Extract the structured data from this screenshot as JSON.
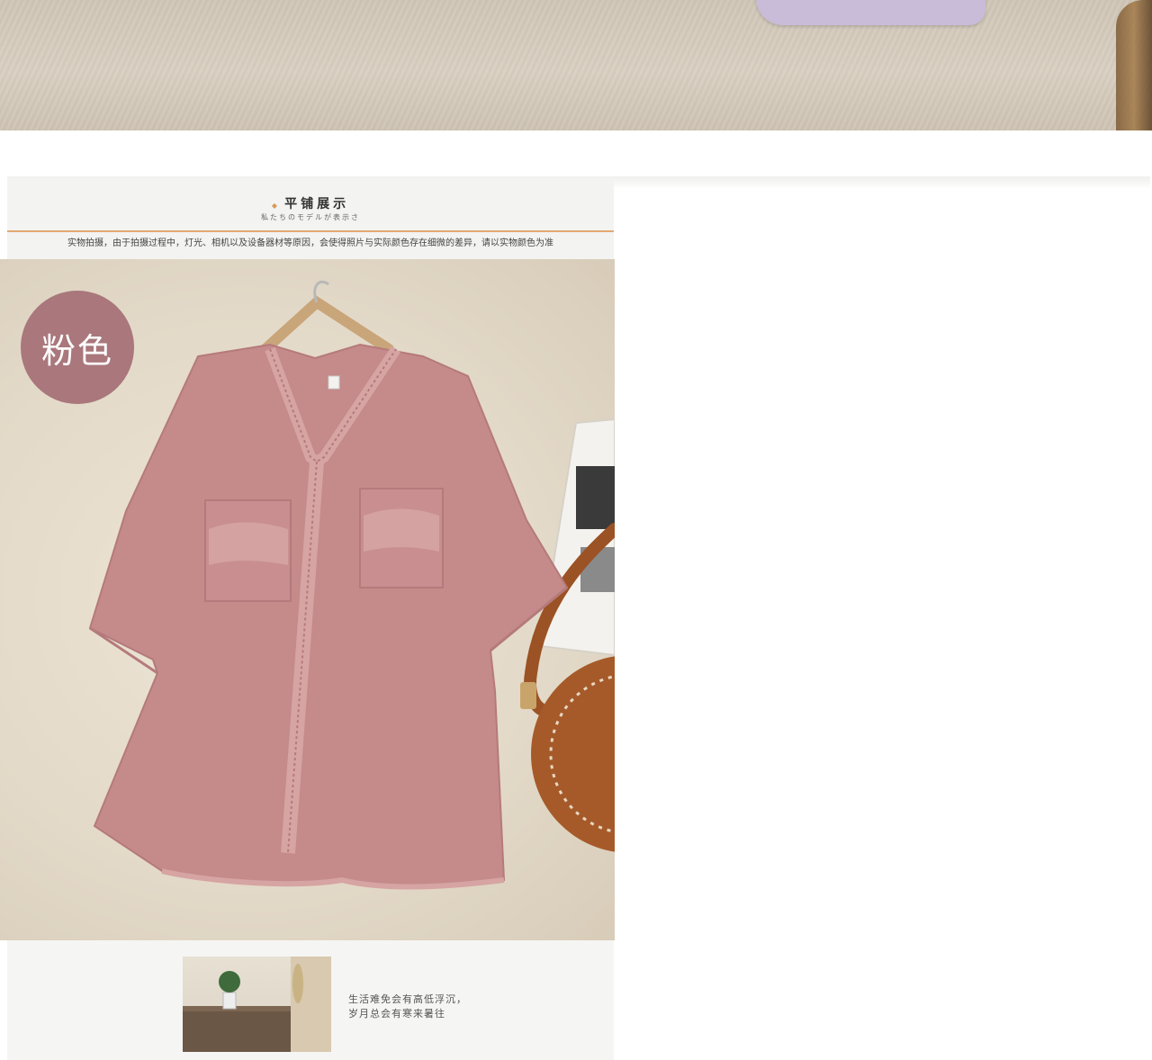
{
  "section": {
    "title": "平铺展示",
    "subtitle": "私たちのモデルが表示さ",
    "notice": "实物拍摄，由于拍摄过程中，灯光、相机以及设备器材等原因，会使得照片与实际颜色存在细微的差异，请以实物颜色为准"
  },
  "product": {
    "color_label": "粉色",
    "colors": {
      "badge": "#a9777c",
      "shirt": "#c58a8a",
      "accent": "#e2a873"
    }
  },
  "footer": {
    "line1": "生活难免会有高低浮沉，",
    "line2": "岁月总会有寒来暑往"
  }
}
